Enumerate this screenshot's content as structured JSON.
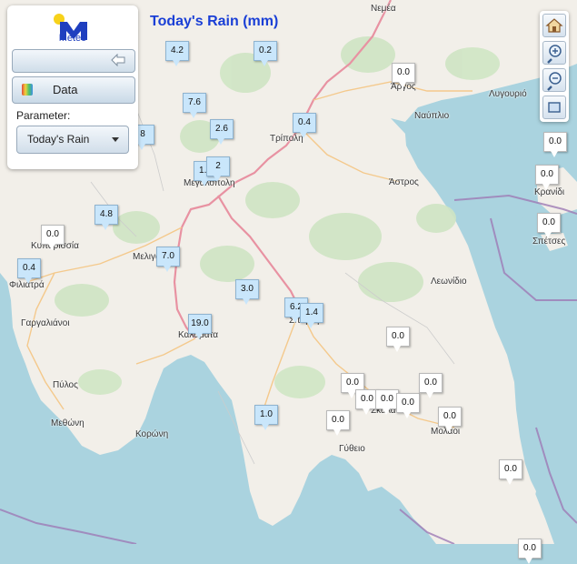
{
  "title": "Today's Rain (mm)",
  "logo_text": "Meteo",
  "panel": {
    "data_label": "Data",
    "parameter_label": "Parameter:",
    "parameter_value": "Today's Rain"
  },
  "tools": [
    "home-icon",
    "zoom-in-icon",
    "zoom-out-icon",
    "fit-extent-icon"
  ],
  "colors": {
    "title": "#1a3fd6",
    "rain_marker": "#c9e6fb",
    "zero_marker": "#ffffff",
    "sea": "#aad3df",
    "land": "#f2efe9"
  },
  "places": [
    {
      "name": "Νεμέα"
    },
    {
      "name": "Άργος"
    },
    {
      "name": "Λυγουριό"
    },
    {
      "name": "Ναύπλιο"
    },
    {
      "name": "Τρίπολη"
    },
    {
      "name": "Μεγαλόπολη"
    },
    {
      "name": "Άστρος"
    },
    {
      "name": "Κρανίδι"
    },
    {
      "name": "Σπέτσες"
    },
    {
      "name": "Κυπαρισσία"
    },
    {
      "name": "Μελιγαλάς"
    },
    {
      "name": "Φιλιατρά"
    },
    {
      "name": "Λεωνίδιο"
    },
    {
      "name": "Σπάρτη"
    },
    {
      "name": "Γαργαλιάνοι"
    },
    {
      "name": "Καλαμάτα"
    },
    {
      "name": "Πύλος"
    },
    {
      "name": "Μεθώνη"
    },
    {
      "name": "Κορώνη"
    },
    {
      "name": "Σκάλα"
    },
    {
      "name": "Μολάοι"
    },
    {
      "name": "Γύθειο"
    }
  ],
  "stations": [
    {
      "value": "4.2"
    },
    {
      "value": "0.2"
    },
    {
      "value": "0.0"
    },
    {
      "value": "7.6"
    },
    {
      "value": "2.6"
    },
    {
      "value": "0.4"
    },
    {
      "value": "8"
    },
    {
      "value": "1.0"
    },
    {
      "value": "2"
    },
    {
      "value": "0.0"
    },
    {
      "value": "0.0"
    },
    {
      "value": "0.0"
    },
    {
      "value": "4.8"
    },
    {
      "value": "0.0"
    },
    {
      "value": "7.0"
    },
    {
      "value": "0.4"
    },
    {
      "value": "3.0"
    },
    {
      "value": "6.2"
    },
    {
      "value": "1.4"
    },
    {
      "value": "19.0"
    },
    {
      "value": "0.0"
    },
    {
      "value": "0.0"
    },
    {
      "value": "0.0"
    },
    {
      "value": "0.0"
    },
    {
      "value": "0.0"
    },
    {
      "value": "0.0"
    },
    {
      "value": "1.0"
    },
    {
      "value": "0.0"
    },
    {
      "value": "0.0"
    },
    {
      "value": "0.0"
    },
    {
      "value": "0.0"
    }
  ]
}
